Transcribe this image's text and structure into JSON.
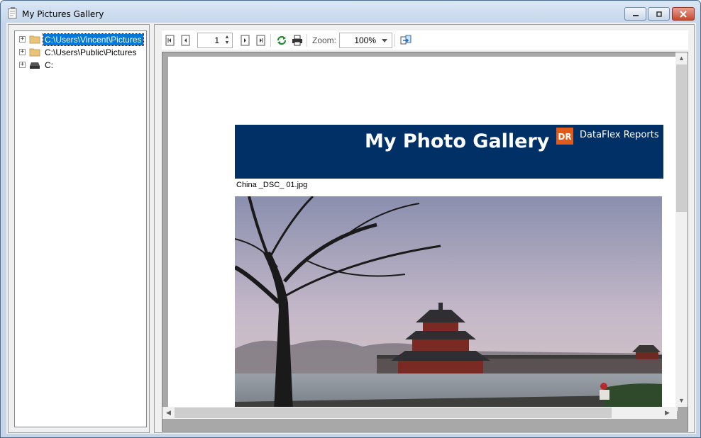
{
  "window": {
    "title": "My Pictures Gallery",
    "icon": "notepad-document-icon"
  },
  "tree": {
    "items": [
      {
        "label": "C:\\Users\\Vincent\\Pictures",
        "icon": "folder-icon",
        "selected": true
      },
      {
        "label": "C:\\Users\\Public\\Pictures",
        "icon": "folder-icon",
        "selected": false
      },
      {
        "label": "C:",
        "icon": "drive-icon",
        "selected": false
      }
    ]
  },
  "toolbar": {
    "page_value": "1",
    "zoom_label": "Zoom:",
    "zoom_value": "100%"
  },
  "report": {
    "banner_title": "My Photo Gallery",
    "brand_logo_text": "DR",
    "brand_name": "DataFlex Reports",
    "filename": "China _DSC_ 01.jpg"
  },
  "colors": {
    "banner": "#003066",
    "brand_logo": "#e05a1e",
    "selection": "#0078d7"
  }
}
